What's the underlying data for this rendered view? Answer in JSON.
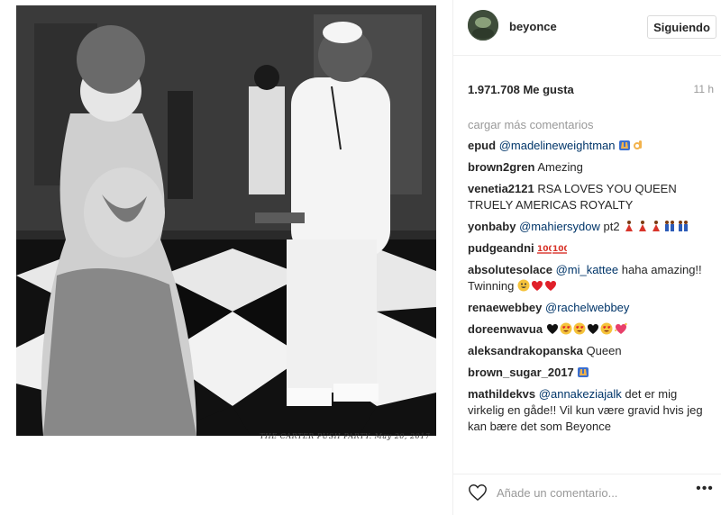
{
  "post": {
    "username": "beyonce",
    "follow_label": "Siguiendo",
    "likes": "1.971.708 Me gusta",
    "time": "11 h",
    "photo_caption": "THE CARTER PUSH PARTY. May 20, 2017",
    "load_more": "cargar más comentarios"
  },
  "comments": [
    {
      "user": "epud",
      "mention": "@madelineweightman",
      "text": "",
      "emojis": [
        "raised-hands",
        "ok-hand"
      ]
    },
    {
      "user": "brown2gren",
      "mention": "",
      "text": "Amezing",
      "emojis": []
    },
    {
      "user": "venetia2121",
      "mention": "",
      "text": "RSA LOVES YOU QUEEN TRUELY AMERICAS ROYALTY",
      "emojis": []
    },
    {
      "user": "yonbaby",
      "mention": "@mahiersydow",
      "text": "pt2",
      "emojis": [
        "dancer-red",
        "dancer-red",
        "dancer-red",
        "dancers-blue",
        "dancers-blue"
      ]
    },
    {
      "user": "pudgeandni",
      "mention": "",
      "text": "",
      "emojis": [
        "100",
        "100"
      ]
    },
    {
      "user": "absolutesolace",
      "mention": "@mi_kattee",
      "text": "haha amazing!! Twinning",
      "emojis": [
        "grin",
        "red-heart",
        "red-heart"
      ]
    },
    {
      "user": "renaewebbey",
      "mention": "@rachelwebbey",
      "text": "",
      "emojis": []
    },
    {
      "user": "doreenwavua",
      "mention": "",
      "text": "",
      "emojis": [
        "black-heart",
        "heart-eyes",
        "heart-eyes",
        "black-heart",
        "heart-eyes",
        "sparkling-heart"
      ]
    },
    {
      "user": "aleksandrakopanska",
      "mention": "",
      "text": "Queen",
      "emojis": []
    },
    {
      "user": "brown_sugar_2017",
      "mention": "",
      "text": "",
      "emojis": [
        "raised-hands"
      ]
    },
    {
      "user": "mathildekvs",
      "mention": "@annakeziajalk",
      "text": "det er mig virkelig en gåde!! Vil kun være gravid hvis jeg kan bære det som Beyonce",
      "emojis": []
    }
  ],
  "composer": {
    "placeholder": "Añade un comentario...",
    "more_label": "•••"
  },
  "colors": {
    "mention": "#003569",
    "muted": "#999999",
    "border": "#efefef",
    "text": "#262626"
  }
}
